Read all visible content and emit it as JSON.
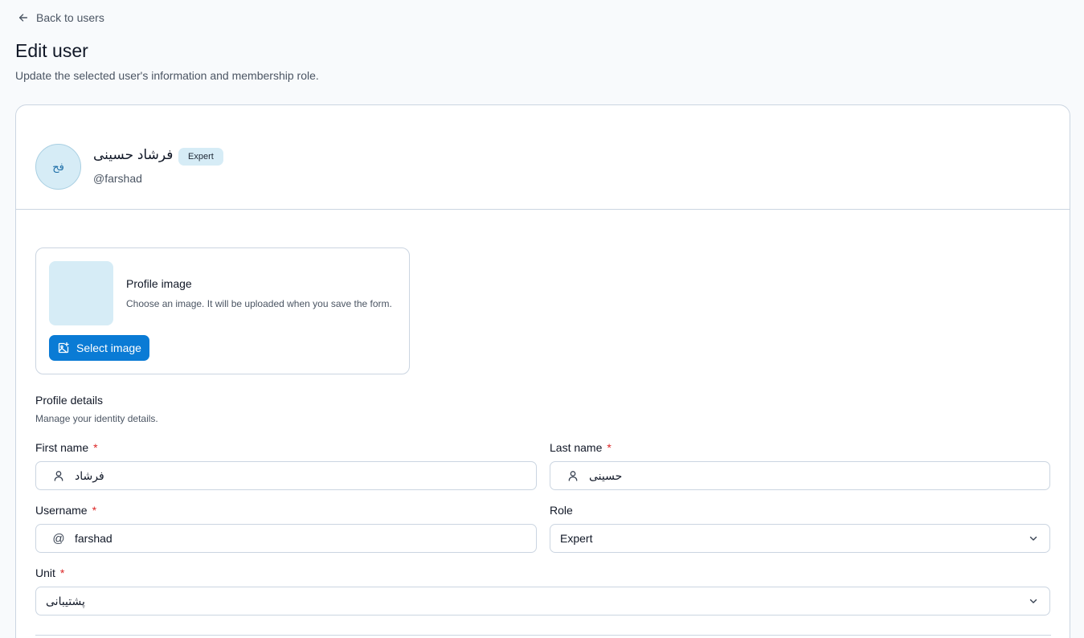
{
  "nav": {
    "back_label": "Back to users"
  },
  "page": {
    "title": "Edit user",
    "subtitle": "Update the selected user's information and membership role."
  },
  "user": {
    "initials": "فح",
    "full_name": "فرشاد حسینی",
    "role_badge": "Expert",
    "handle": "@farshad"
  },
  "profile_image": {
    "title": "Profile image",
    "description": "Choose an image. It will be uploaded when you save the form.",
    "button_label": "Select image"
  },
  "profile_details": {
    "title": "Profile details",
    "description": "Manage your identity details."
  },
  "fields": {
    "first_name": {
      "label": "First name",
      "required_mark": "*",
      "value": "فرشاد"
    },
    "last_name": {
      "label": "Last name",
      "required_mark": "*",
      "value": "حسینی"
    },
    "username": {
      "label": "Username",
      "required_mark": "*",
      "value": "farshad",
      "prefix": "@"
    },
    "role": {
      "label": "Role",
      "value": "Expert"
    },
    "unit": {
      "label": "Unit",
      "required_mark": "*",
      "value": "پشتیبانی"
    }
  },
  "colors": {
    "accent": "#0a7bd5",
    "avatar_bg": "#d6ecf6",
    "required": "#dc2626",
    "border": "#cbd5e1",
    "page_bg": "#f8fafc"
  },
  "icons": {
    "back": "arrow-left-icon",
    "select_image": "image-plus-icon",
    "name_field": "user-icon",
    "dropdown": "chevron-down-icon"
  }
}
